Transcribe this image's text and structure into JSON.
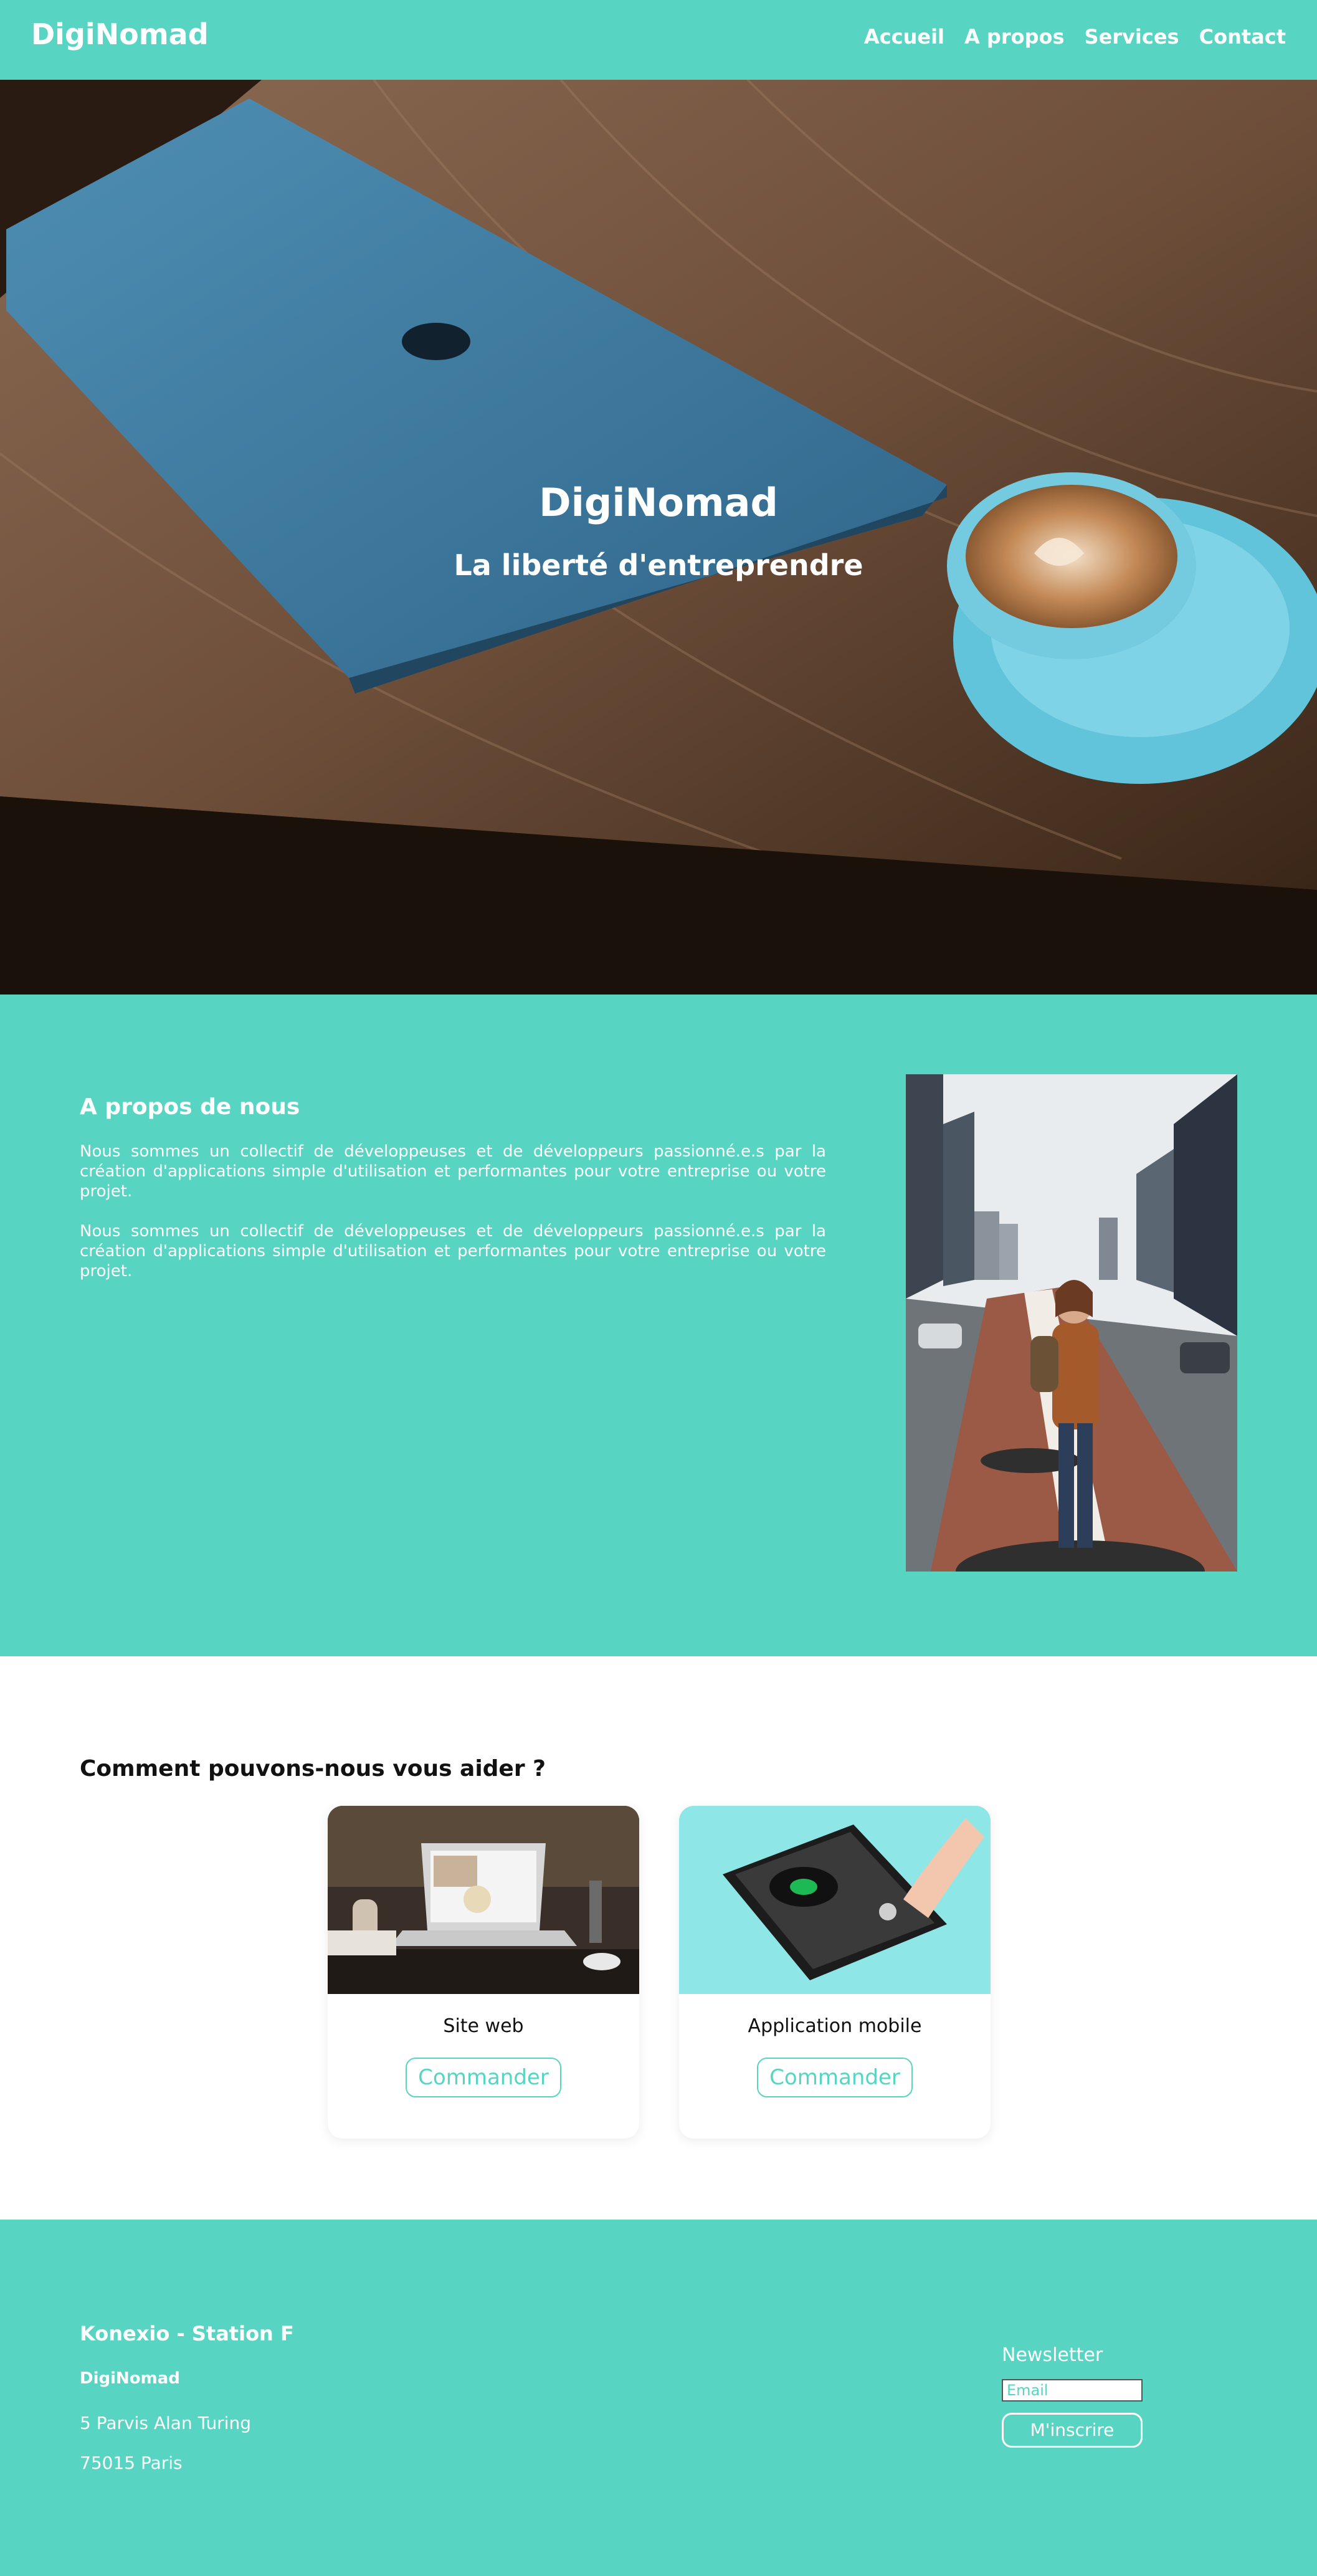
{
  "header": {
    "logo": "DigiNomad",
    "nav": [
      "Accueil",
      "A propos",
      "Services",
      "Contact"
    ]
  },
  "hero": {
    "title": "DigiNomad",
    "subtitle": "La liberté d'entreprendre"
  },
  "about": {
    "title": "A propos de nous",
    "paragraphs": [
      "Nous sommes un collectif de développeuses et de développeurs passionné.e.s par la création d'applications simple d'utilisation et performantes pour votre entreprise ou votre projet.",
      "Nous sommes un collectif de développeuses et de développeurs passionné.e.s par la création d'applications simple d'utilisation et performantes pour votre entreprise ou votre projet."
    ]
  },
  "services": {
    "title": "Comment pouvons-nous vous aider ?",
    "cards": [
      {
        "label": "Site web",
        "button": "Commander"
      },
      {
        "label": "Application mobile",
        "button": "Commander"
      }
    ]
  },
  "footer": {
    "company": "Konexio - Station F",
    "brand": "DigiNomad",
    "address_line1": "5 Parvis Alan Turing",
    "address_line2": "75015 Paris",
    "newsletter_label": "Newsletter",
    "email_placeholder": "Email",
    "subscribe_button": "M'inscrire"
  },
  "colors": {
    "accent": "#57d5c2",
    "text_light": "#ffffff",
    "text_dark": "#111111"
  }
}
